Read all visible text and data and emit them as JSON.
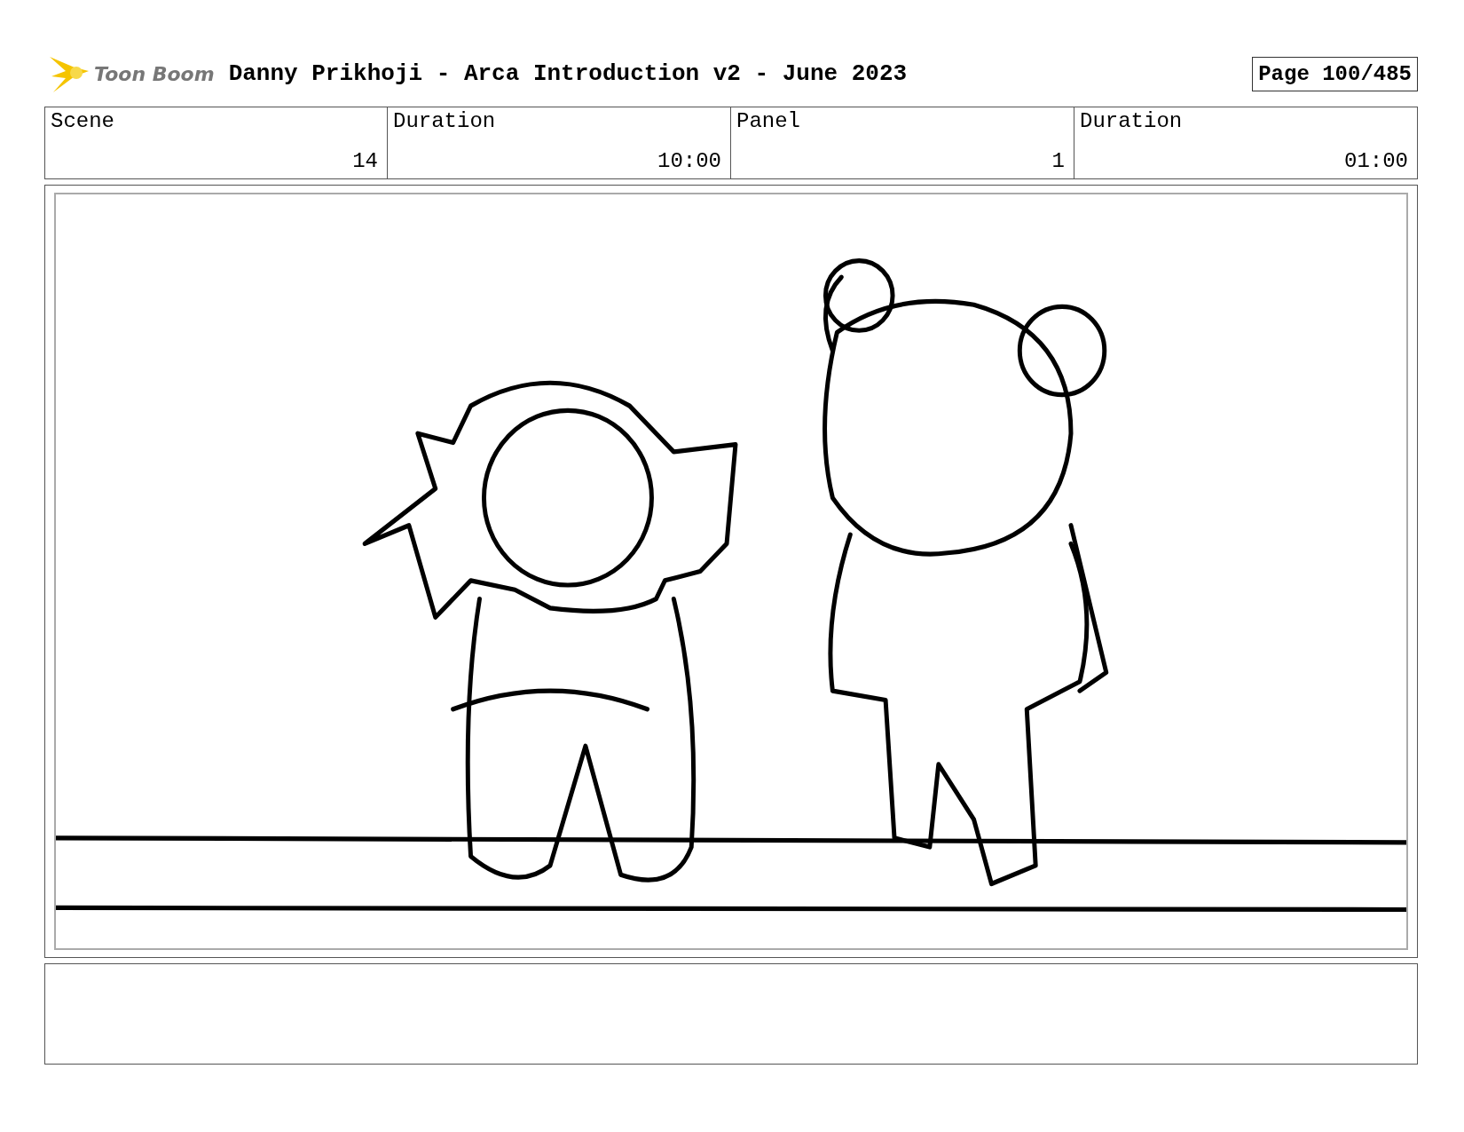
{
  "header": {
    "logo": "Toon Boom",
    "title": "Danny Prikhoji - Arca Introduction v2 - June 2023",
    "page": "Page 100/485"
  },
  "info_table": {
    "columns": [
      "Scene",
      "Duration",
      "Panel",
      "Duration"
    ],
    "row": [
      "14",
      "10:00",
      "1",
      "01:00"
    ]
  }
}
